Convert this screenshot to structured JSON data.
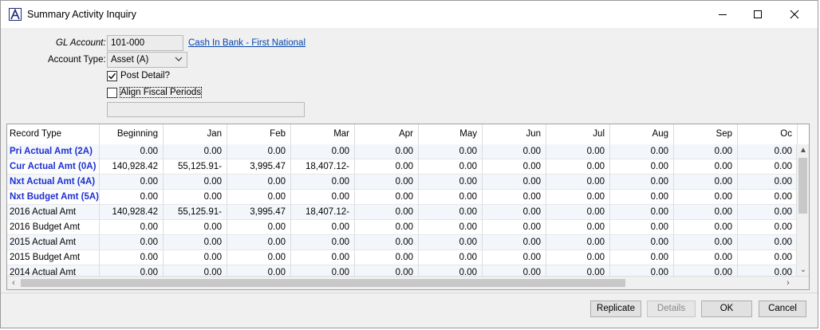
{
  "window": {
    "title": "Summary Activity Inquiry"
  },
  "form": {
    "gl_account_label": "GL Account:",
    "gl_account_value": "101-000",
    "gl_account_link": "Cash In Bank - First National",
    "account_type_label": "Account Type:",
    "account_type_value": "Asset (A)",
    "post_detail_label": "Post Detail?",
    "post_detail_checked": true,
    "align_fiscal_label": "Align Fiscal Periods",
    "align_fiscal_checked": false,
    "extra_field_value": ""
  },
  "grid": {
    "columns": [
      "Record Type",
      "Beginning",
      "Jan",
      "Feb",
      "Mar",
      "Apr",
      "May",
      "Jun",
      "Jul",
      "Aug",
      "Sep",
      "Oc"
    ],
    "rows": [
      {
        "type": "Pri Actual Amt (2A)",
        "blue": true,
        "values": [
          "0.00",
          "0.00",
          "0.00",
          "0.00",
          "0.00",
          "0.00",
          "0.00",
          "0.00",
          "0.00",
          "0.00",
          "0.00"
        ]
      },
      {
        "type": "Cur Actual Amt (0A)",
        "blue": true,
        "values": [
          "140,928.42",
          "55,125.91-",
          "3,995.47",
          "18,407.12-",
          "0.00",
          "0.00",
          "0.00",
          "0.00",
          "0.00",
          "0.00",
          "0.00"
        ]
      },
      {
        "type": "Nxt Actual Amt (4A)",
        "blue": true,
        "values": [
          "0.00",
          "0.00",
          "0.00",
          "0.00",
          "0.00",
          "0.00",
          "0.00",
          "0.00",
          "0.00",
          "0.00",
          "0.00"
        ]
      },
      {
        "type": "Nxt Budget Amt (5A)",
        "blue": true,
        "values": [
          "0.00",
          "0.00",
          "0.00",
          "0.00",
          "0.00",
          "0.00",
          "0.00",
          "0.00",
          "0.00",
          "0.00",
          "0.00"
        ]
      },
      {
        "type": "2016 Actual Amt",
        "blue": false,
        "values": [
          "140,928.42",
          "55,125.91-",
          "3,995.47",
          "18,407.12-",
          "0.00",
          "0.00",
          "0.00",
          "0.00",
          "0.00",
          "0.00",
          "0.00"
        ]
      },
      {
        "type": "2016 Budget Amt",
        "blue": false,
        "values": [
          "0.00",
          "0.00",
          "0.00",
          "0.00",
          "0.00",
          "0.00",
          "0.00",
          "0.00",
          "0.00",
          "0.00",
          "0.00"
        ]
      },
      {
        "type": "2015 Actual Amt",
        "blue": false,
        "values": [
          "0.00",
          "0.00",
          "0.00",
          "0.00",
          "0.00",
          "0.00",
          "0.00",
          "0.00",
          "0.00",
          "0.00",
          "0.00"
        ]
      },
      {
        "type": "2015 Budget Amt",
        "blue": false,
        "values": [
          "0.00",
          "0.00",
          "0.00",
          "0.00",
          "0.00",
          "0.00",
          "0.00",
          "0.00",
          "0.00",
          "0.00",
          "0.00"
        ]
      },
      {
        "type": "2014 Actual Amt",
        "blue": false,
        "values": [
          "0.00",
          "0.00",
          "0.00",
          "0.00",
          "0.00",
          "0.00",
          "0.00",
          "0.00",
          "0.00",
          "0.00",
          "0.00"
        ]
      }
    ]
  },
  "buttons": {
    "replicate": "Replicate",
    "details": "Details",
    "ok": "OK",
    "cancel": "Cancel"
  },
  "icons": {
    "app": "app-logo-icon",
    "minimize": "minimize-icon",
    "maximize": "maximize-icon",
    "close": "close-icon"
  },
  "colors": {
    "link": "#0645ad",
    "highlight_rows": "#1f2fd1",
    "alt_row": "#f3f7fc"
  }
}
